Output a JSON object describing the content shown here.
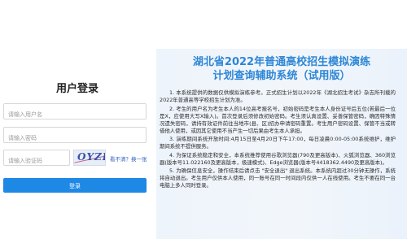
{
  "login": {
    "title": "用户登录",
    "username_placeholder": "请输入用户名",
    "password_placeholder": "请输入密码",
    "captcha_placeholder": "请输入验证码",
    "captcha_text": "OYZP",
    "refresh_link": "看不清？换一张",
    "submit_label": "登录"
  },
  "info": {
    "title_line1": "湖北省2022年普通高校招生模拟演练",
    "title_line2": "计划查询辅助系统（试用版）",
    "notices": [
      "1. 本系统提供的数据仅供模拟演练参考。正式招生计划以2022年《湖北招生考试》杂志所刊载的2022年普通高等学校招生计划为准。",
      "2. 考生的用户名为考生本人的14位高考报名号，初始密码是考生本人身份证号后五位(若最后一位是X，应使用大写X输入)。首次登录后须修改初始密码。考生须认真设置、妥善保管密码，确因特殊情况遗失密码，请持有效证件前往当地市(县、区)招办申请密码重置。考生用户密码设置、保管不当或转借他人使用，或因其它使用不当产生一切后果由考生本人承担。",
      "3. 演练期间系统开放时间:4月15日至4月20日下午17:00，每日凌晨0:00-05:00系统维护，维护期间系统不提供服务。",
      "4. 为保证系统稳定和安全，本系统推荐使用谷歌浏览器(790及更高版本)、火狐浏览器、360浏览器(版本号11.022160及更高版本，极速模式)、Edge浏览器(版本号4418362.4490及更高版本)。",
      "5. 为确保信息安全，操作结束后请点击 \"安全退出\" 退出系统。本系统内超过30分钟无操作，系统将自动退出。考生用户仅供本人使用，同一账号在同一时间段内仅供一人在线使用。考生不要在同一台电脑上多人同时登录。"
    ]
  }
}
